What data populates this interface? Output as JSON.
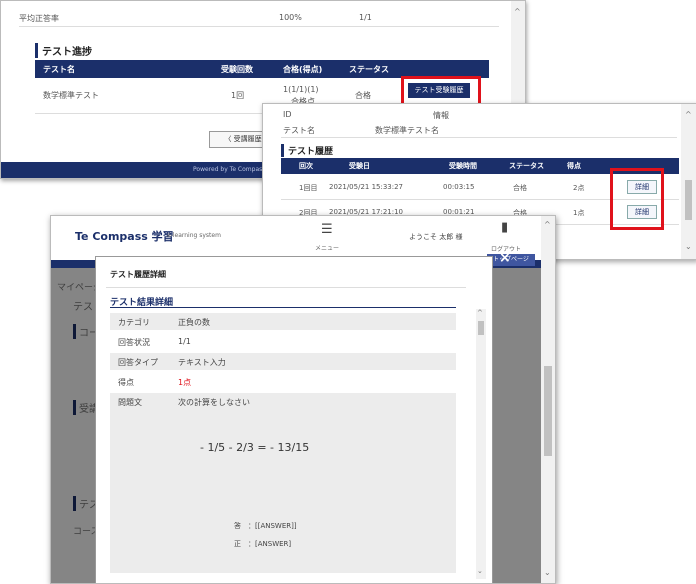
{
  "shot1": {
    "top_row": {
      "label": "平均正答率",
      "percent": "100%",
      "count": "1/1"
    },
    "section_title": "テスト進捗",
    "table_headers": [
      "テスト名",
      "受験回数",
      "合格(得点)",
      "ステータス"
    ],
    "row": {
      "name": "数学標準テスト",
      "attempts": "1回",
      "score": "1(1/1)(1)",
      "score_sub": "合格点",
      "status": "合格"
    },
    "detail_button": "テスト受験履歴",
    "back_button": "〈 受講履歴",
    "footer_text": "Powered by Te Compass"
  },
  "shot2": {
    "info_rows": [
      {
        "k": "ID",
        "v": "情報"
      },
      {
        "k": "テスト名",
        "v": "数学標準テスト名"
      }
    ],
    "section_title": "テスト履歴",
    "table_headers": [
      "回次",
      "受験日",
      "受験時間",
      "ステータス",
      "得点"
    ],
    "rows": [
      {
        "round": "1回目",
        "date": "2021/05/21 15:33:27",
        "time": "00:03:15",
        "status": "合格",
        "score": "2点",
        "btn": "詳細"
      },
      {
        "round": "2回目",
        "date": "2021/05/21 17:21:10",
        "time": "00:01:21",
        "status": "合格",
        "score": "1点",
        "btn": "詳細"
      }
    ]
  },
  "shot3": {
    "logo": "Te Compass 学習",
    "logo_sub": "e-learning system",
    "menu_label": "メニュー",
    "user_label": "ようこそ 太郎 様",
    "logout_label": "ログアウト",
    "page_tab": "トップページ",
    "bg_items": [
      "マイページ",
      "テスト",
      "コース",
      "テスト",
      "受講状況",
      "テスト",
      "コース"
    ],
    "modal": {
      "title": "テスト履歴詳細",
      "section": "テスト結果詳細",
      "rows": [
        {
          "k": "カテゴリ",
          "v": "正負の数"
        },
        {
          "k": "回答状況",
          "v": "1/1"
        },
        {
          "k": "回答タイプ",
          "v": "テキスト入力"
        },
        {
          "k": "得点",
          "v": "1点"
        },
        {
          "k": "問題文",
          "v": "次の計算をしなさい"
        }
      ],
      "formula": "- 1/5 - 2/3 = - 13/15",
      "answer_a": "答　：[[ANSWER]]",
      "answer_b": "正　：[ANSWER]",
      "close": "×"
    }
  }
}
